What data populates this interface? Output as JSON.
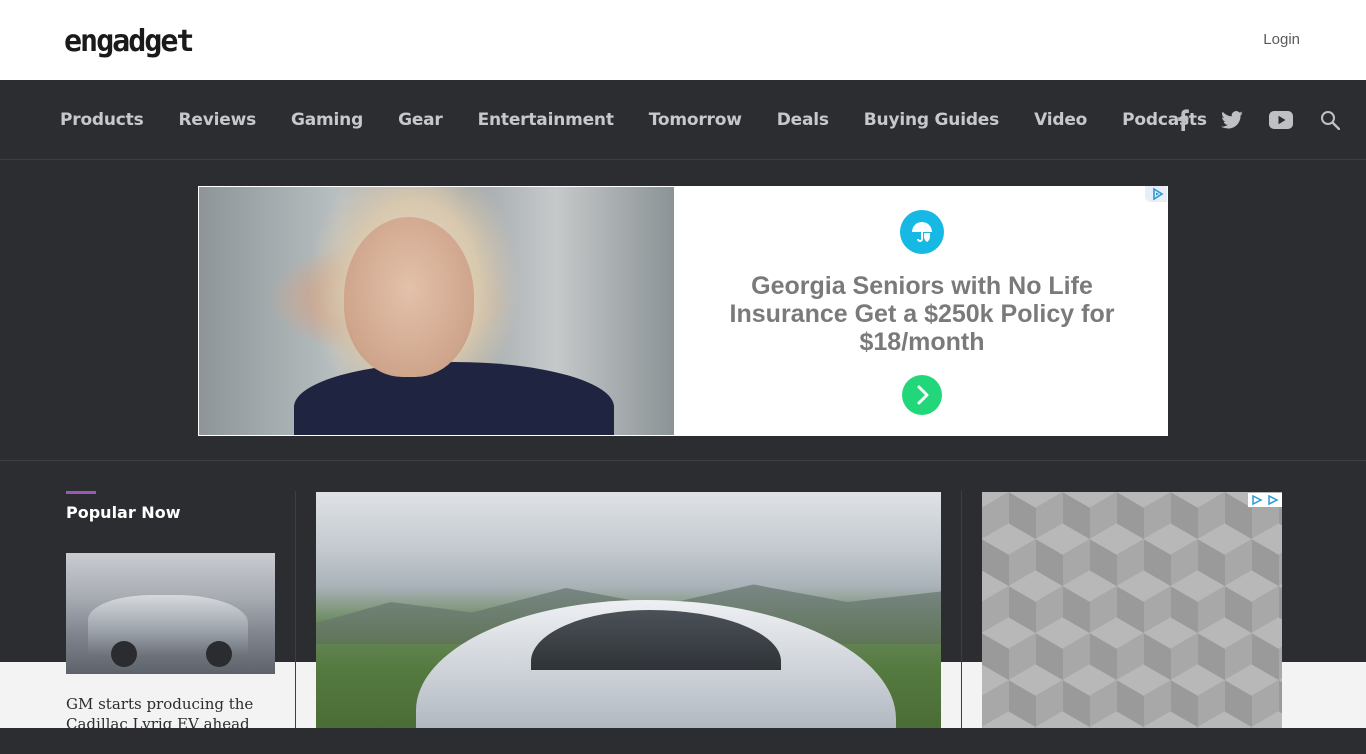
{
  "header": {
    "logo_text": "engadget",
    "login_label": "Login"
  },
  "nav": {
    "items": [
      "Products",
      "Reviews",
      "Gaming",
      "Gear",
      "Entertainment",
      "Tomorrow",
      "Deals",
      "Buying Guides",
      "Video",
      "Podcasts"
    ],
    "icons": [
      "facebook-icon",
      "twitter-icon",
      "youtube-icon",
      "search-icon"
    ]
  },
  "ad": {
    "headline": "Georgia Seniors with No Life Insurance Get a $250k Policy for $18/month"
  },
  "popular": {
    "title": "Popular Now",
    "headline": "GM starts producing the Cadillac Lyriq EV ahead of"
  },
  "colors": {
    "nav_bg": "#2c2d30",
    "accent": "#9b59b6",
    "ad_logo": "#16b8e4",
    "ad_arrow": "#21d77a"
  }
}
